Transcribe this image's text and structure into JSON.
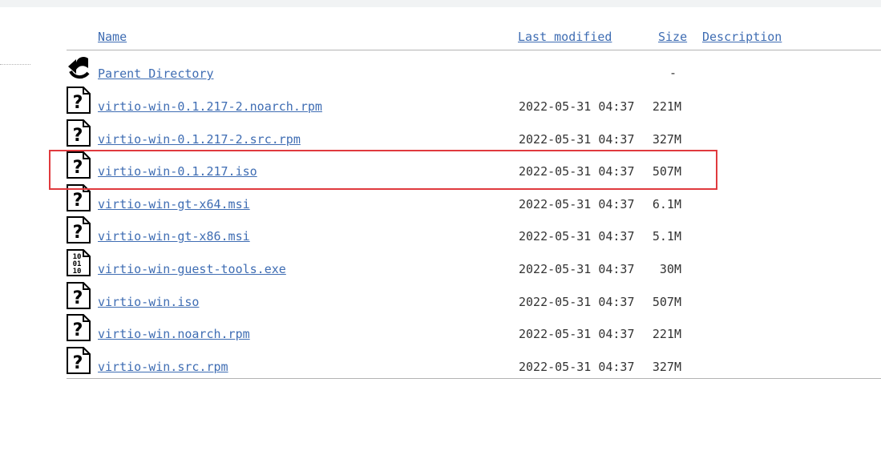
{
  "header": {
    "name_label": "Name",
    "last_modified_label": "Last modified",
    "size_label": "Size",
    "description_label": "Description"
  },
  "parent": {
    "label": "Parent Directory",
    "size": "-",
    "icon": "back-arrow-icon"
  },
  "files": [
    {
      "name": "virtio-win-0.1.217-2.noarch.rpm",
      "modified": "2022-05-31 04:37",
      "size": "221M",
      "icon": "unknown-file-icon"
    },
    {
      "name": "virtio-win-0.1.217-2.src.rpm",
      "modified": "2022-05-31 04:37",
      "size": "327M",
      "icon": "unknown-file-icon"
    },
    {
      "name": "virtio-win-0.1.217.iso",
      "modified": "2022-05-31 04:37",
      "size": "507M",
      "icon": "unknown-file-icon"
    },
    {
      "name": "virtio-win-gt-x64.msi",
      "modified": "2022-05-31 04:37",
      "size": "6.1M",
      "icon": "unknown-file-icon"
    },
    {
      "name": "virtio-win-gt-x86.msi",
      "modified": "2022-05-31 04:37",
      "size": "5.1M",
      "icon": "unknown-file-icon"
    },
    {
      "name": "virtio-win-guest-tools.exe",
      "modified": "2022-05-31 04:37",
      "size": "30M",
      "icon": "binary-file-icon"
    },
    {
      "name": "virtio-win.iso",
      "modified": "2022-05-31 04:37",
      "size": "507M",
      "icon": "unknown-file-icon"
    },
    {
      "name": "virtio-win.noarch.rpm",
      "modified": "2022-05-31 04:37",
      "size": "221M",
      "icon": "unknown-file-icon"
    },
    {
      "name": "virtio-win.src.rpm",
      "modified": "2022-05-31 04:37",
      "size": "327M",
      "icon": "unknown-file-icon"
    }
  ],
  "colors": {
    "link": "#3f6db3",
    "text": "#333333",
    "highlight": "#e03a3e",
    "rule": "#b4b4b4"
  }
}
